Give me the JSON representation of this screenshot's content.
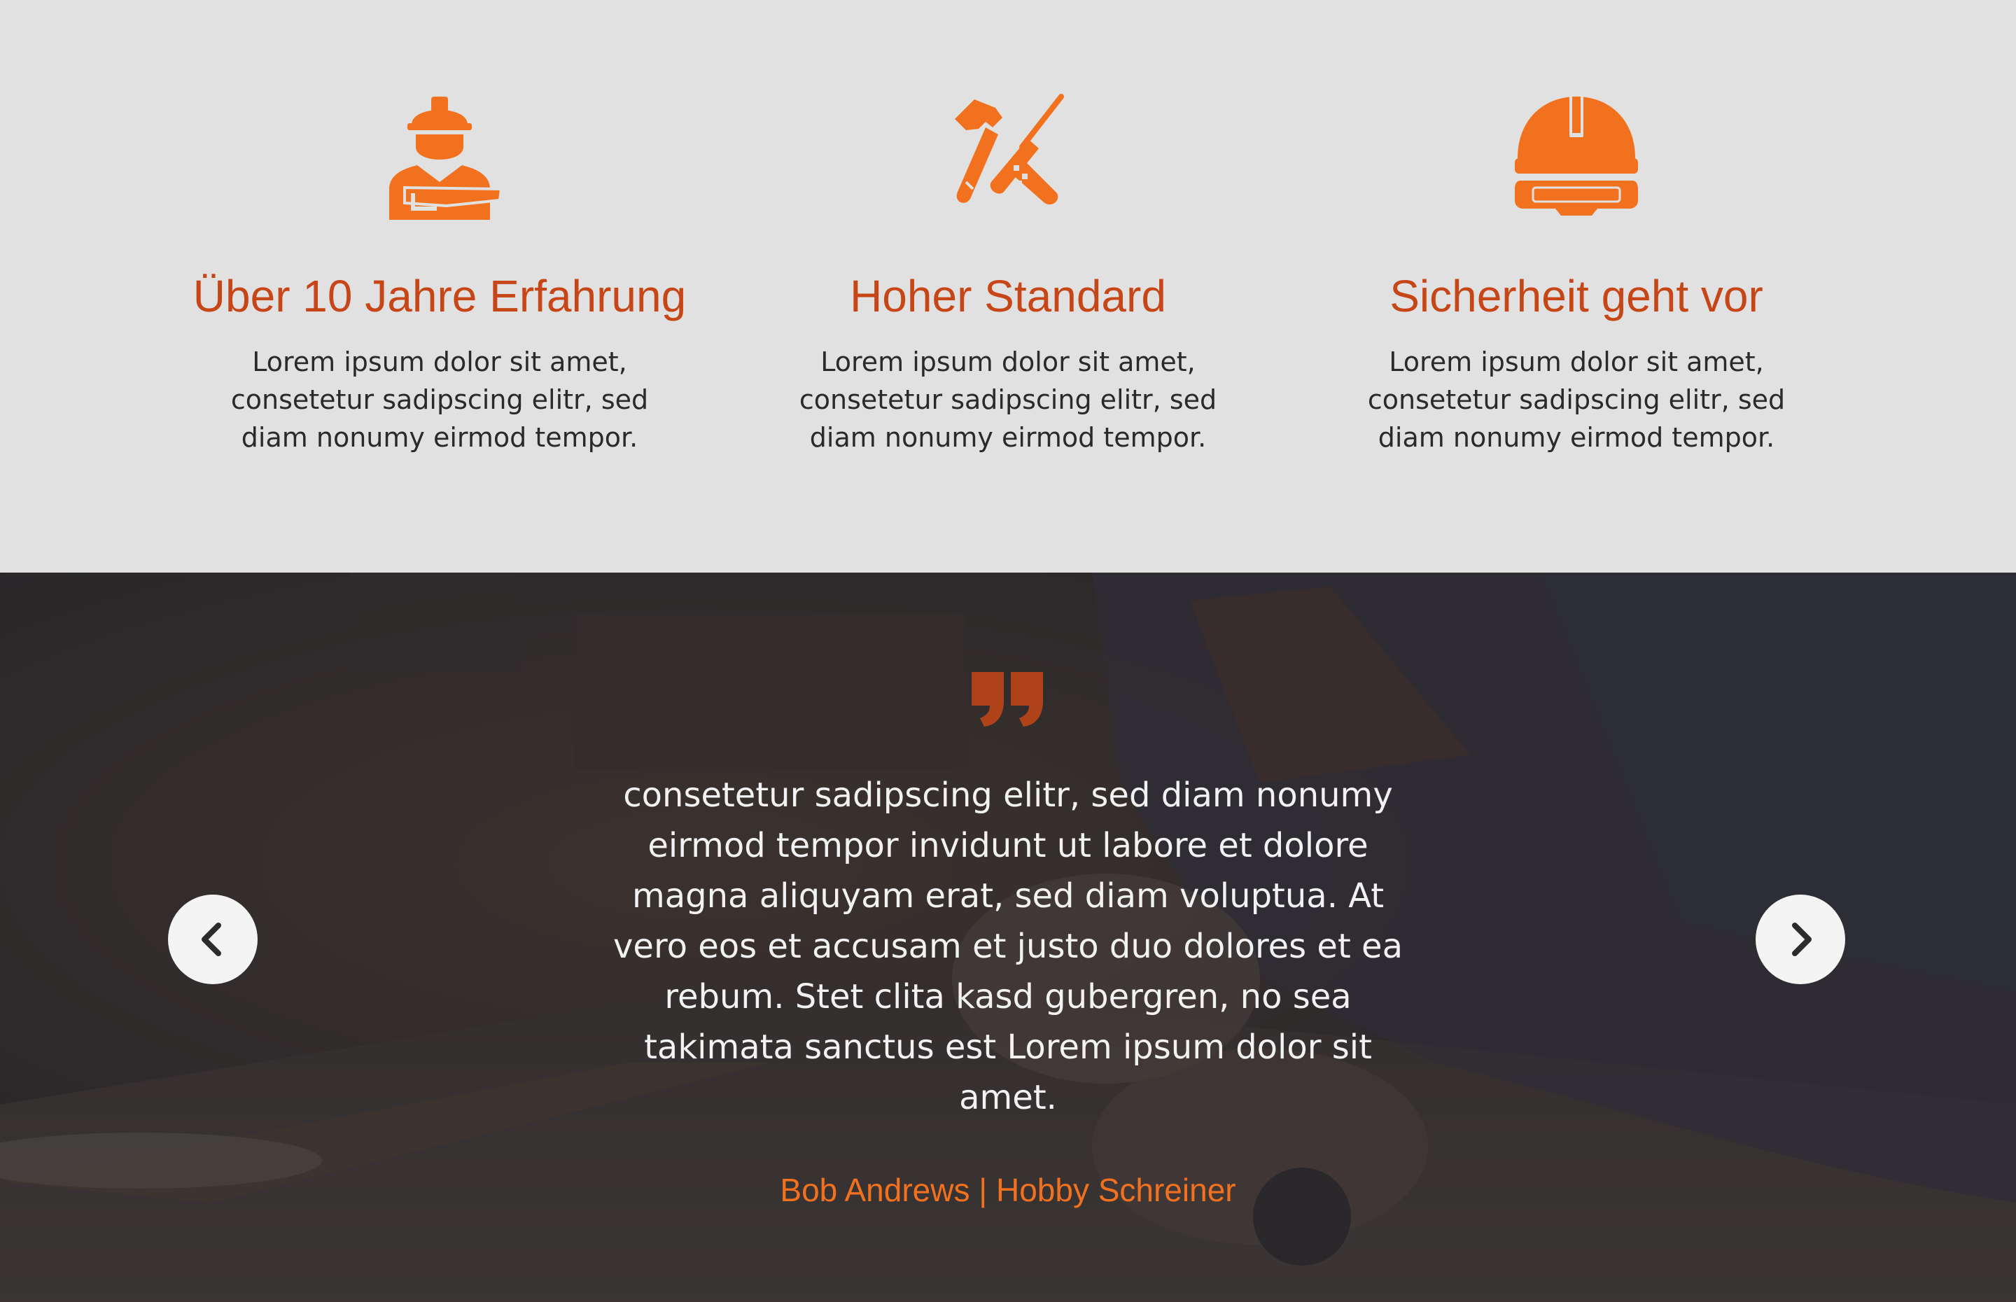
{
  "colors": {
    "accent": "#f2711e",
    "title": "#c74617",
    "features_bg": "#e1e1e1",
    "testimonial_overlay": "#242326"
  },
  "features": [
    {
      "icon": "worker-icon",
      "title": "Über 10 Jahre Erfahrung",
      "text": "Lorem ipsum dolor sit amet, consetetur sadipscing elitr, sed diam nonumy eirmod tempor."
    },
    {
      "icon": "tools-icon",
      "title": "Hoher Standard",
      "text": "Lorem ipsum dolor sit amet, consetetur sadipscing elitr, sed diam nonumy eirmod tempor."
    },
    {
      "icon": "helmet-icon",
      "title": "Sicherheit geht vor",
      "text": "Lorem ipsum dolor sit amet, consetetur sadipscing elitr, sed diam nonumy eirmod tempor."
    }
  ],
  "testimonial": {
    "quote_icon": "quote-icon",
    "text": "consetetur sadipscing elitr, sed diam nonumy eirmod tempor invidunt ut labore et dolore magna aliquyam erat, sed diam voluptua. At vero eos et accusam et justo duo dolores et ea rebum. Stet clita kasd gubergren, no sea takimata sanctus est Lorem ipsum dolor sit amet.",
    "author": "Bob Andrews | Hobby Schreiner",
    "prev_icon": "chevron-left-icon",
    "next_icon": "chevron-right-icon"
  }
}
